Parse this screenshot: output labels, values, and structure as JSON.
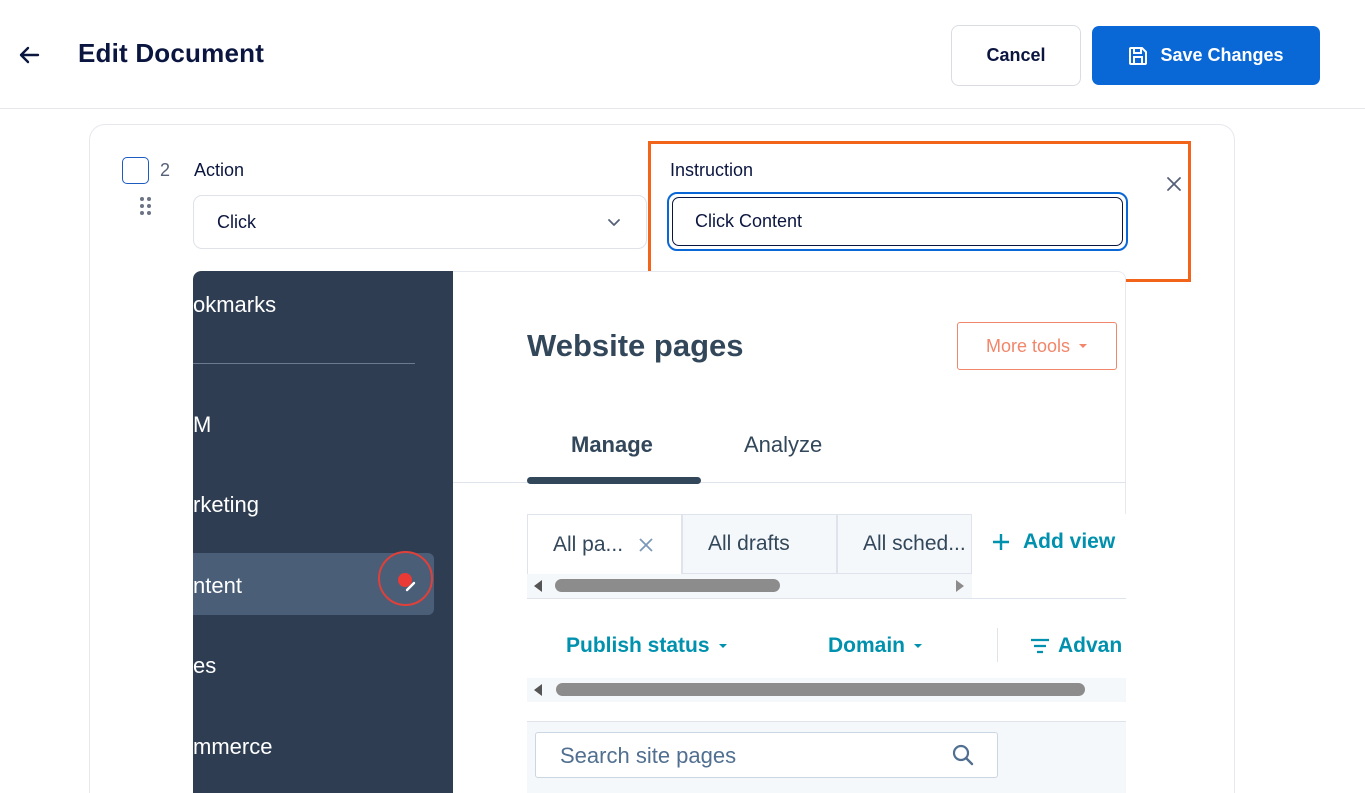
{
  "header": {
    "title": "Edit Document",
    "cancel_label": "Cancel",
    "save_label": "Save Changes"
  },
  "step": {
    "number": "2",
    "action_label": "Action",
    "action_value": "Click",
    "instruction_label": "Instruction",
    "instruction_value": "Click Content"
  },
  "screenshot": {
    "sidebar": {
      "items": [
        "okmarks",
        "M",
        "rketing",
        "ntent",
        "es",
        "mmerce"
      ],
      "active_index": 3
    },
    "title": "Website pages",
    "more_tools_label": "More tools",
    "tabs": [
      "Manage",
      "Analyze"
    ],
    "views": [
      "All pa...",
      "All drafts",
      "All sched..."
    ],
    "add_view_label": "Add view",
    "filters": [
      "Publish status",
      "Domain",
      "Advan"
    ],
    "search_placeholder": "Search site pages"
  },
  "colors": {
    "primary": "#0a68d6",
    "highlight": "#f26419",
    "sidebar": "#2e3d52",
    "link": "#0091ae",
    "accent_orange": "#f2866a",
    "marker_red": "#e93a36"
  },
  "icons": [
    "arrow-left-icon",
    "save-icon",
    "chevron-down-icon",
    "close-icon",
    "drag-handle-icon",
    "search-icon",
    "plus-icon",
    "filter-lines-icon"
  ]
}
